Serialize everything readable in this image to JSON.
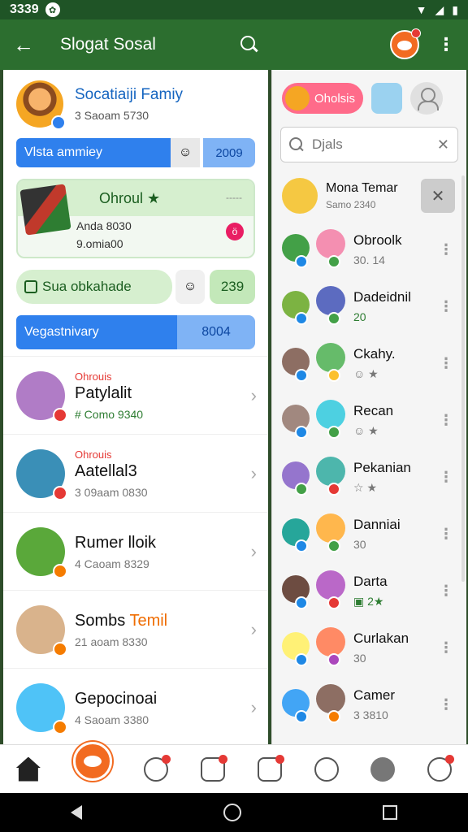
{
  "status": {
    "time": "3339",
    "icon": "notification-icon"
  },
  "app_bar": {
    "title": "Slogat Sosal"
  },
  "profile": {
    "name": "Socatiaiji Famiy",
    "sub": "3 Saoam 5730",
    "row_label": "Vlsta ammiey",
    "row_count": "2009",
    "color_primary": "#2f80ed"
  },
  "group_card": {
    "title": "Ohroul",
    "line1": "Anda 8030",
    "line2": "9.omia00",
    "dots": "-----",
    "pink": "ö"
  },
  "green_row": {
    "label": "Sua obkahade",
    "count": "239"
  },
  "blue_row2": {
    "label": "Vegastnivary",
    "count": "8004"
  },
  "contacts": [
    {
      "tag": "Ohrouis",
      "name": "Patylalit",
      "sub": "# Como 9340",
      "green": true
    },
    {
      "tag": "Ohrouis",
      "name": "Aatellal3",
      "sub": "3 09aam 0830"
    },
    {
      "tag": "",
      "name": "Rumer lloik",
      "sub": "4 Caoam 8329"
    },
    {
      "tag": "",
      "name": "Sombs",
      "name_hl": "Temil",
      "sub": "21 aoam 8330"
    },
    {
      "tag": "",
      "name": "Gepocinoai",
      "sub": "4 Saoam 3380"
    }
  ],
  "right": {
    "chip_label": "Oholsis",
    "search_placeholder": "Djals",
    "top_friend": {
      "name": "Mona Temar",
      "sub": "Samo 2340"
    },
    "friends": [
      {
        "name": "Obroolk",
        "sub": "30. 14"
      },
      {
        "name": "Dadeidnil",
        "sub": "20",
        "green": true
      },
      {
        "name": "Ckahy.",
        "sub": ""
      },
      {
        "name": "Recan",
        "sub": ""
      },
      {
        "name": "Pekanian",
        "sub": ""
      },
      {
        "name": "Danniai",
        "sub": "30"
      },
      {
        "name": "Darta",
        "sub": ""
      },
      {
        "name": "Curlakan",
        "sub": "30"
      },
      {
        "name": "Camer",
        "sub": "3 3810"
      }
    ]
  }
}
